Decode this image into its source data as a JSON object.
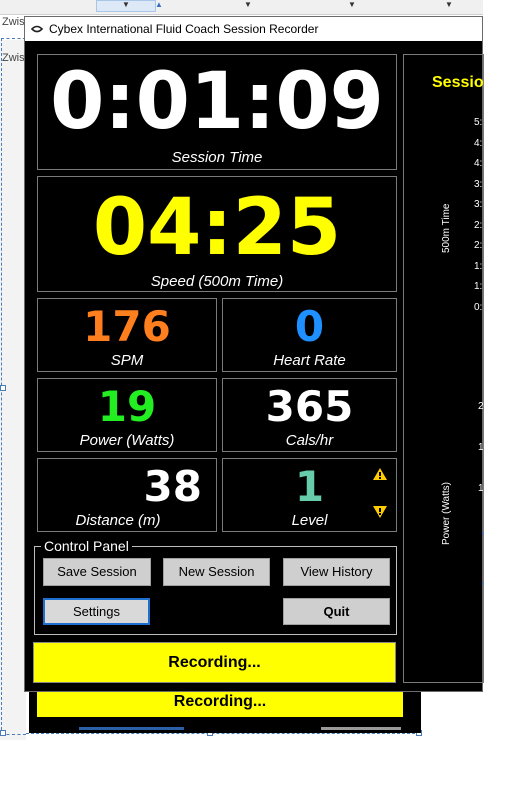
{
  "background": {
    "left_tab_label": "Zwis",
    "ghost_recording_label": "Recording..."
  },
  "window": {
    "title": "Cybex International Fluid Coach Session Recorder"
  },
  "metrics": {
    "session_time": {
      "value": "0:01:09",
      "label": "Session Time"
    },
    "speed": {
      "value": "04:25",
      "label": "Speed (500m Time)"
    },
    "spm": {
      "value": "176",
      "label": "SPM"
    },
    "heart_rate": {
      "value": "0",
      "label": "Heart Rate"
    },
    "power": {
      "value": "19",
      "label": "Power (Watts)"
    },
    "cals": {
      "value": "365",
      "label": "Cals/hr"
    },
    "distance": {
      "value": "38",
      "label": "Distance (m)"
    },
    "level": {
      "value": "1",
      "label": "Level"
    }
  },
  "control_panel": {
    "title": "Control Panel",
    "save_session": "Save Session",
    "new_session": "New Session",
    "view_history": "View History",
    "settings": "Settings",
    "quit": "Quit"
  },
  "recording_label": "Recording...",
  "chart_area": {
    "title": "Sessio",
    "speed_axis_label": "500m Time",
    "power_axis_label": "Power (Watts)",
    "speed_ticks": [
      "5:",
      "4:",
      "4:",
      "3:",
      "3:",
      "2:",
      "2:",
      "1:",
      "1:",
      "0:"
    ],
    "power_ticks": [
      "2",
      "1",
      "1"
    ]
  },
  "colors": {
    "session_time": "#ffffff",
    "speed": "#ffff00",
    "spm": "#ff7f1e",
    "heart_rate": "#1e90ff",
    "power": "#22ee22",
    "cals": "#ffffff",
    "distance": "#ffffff",
    "level": "#66ccaa",
    "chart_title": "#ffff00",
    "recording_bg": "#ffff00"
  }
}
